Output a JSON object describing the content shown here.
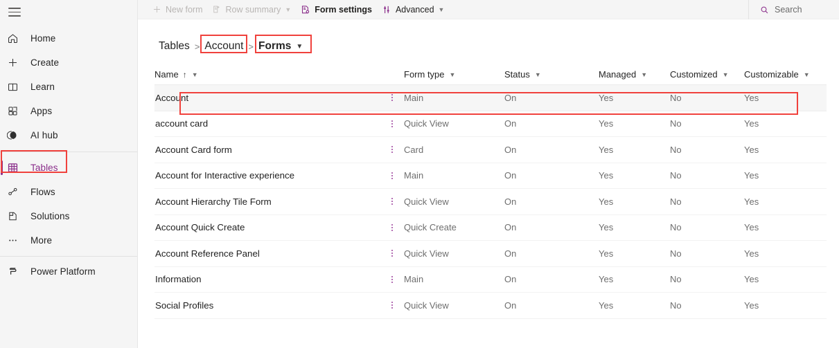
{
  "colors": {
    "accent_purple": "#8a2d8a",
    "annotation_red": "#f0413c",
    "toolbar_bg": "#f5f5f5",
    "sidebar_bg": "#f5f5f5",
    "kebab_purple": "#9b3f9b"
  },
  "sidebar": {
    "menu_button": "hamburger-menu",
    "items": [
      {
        "label": "Home",
        "icon": "home-icon",
        "active": false
      },
      {
        "label": "Create",
        "icon": "plus-icon",
        "active": false
      },
      {
        "label": "Learn",
        "icon": "book-icon",
        "active": false
      },
      {
        "label": "Apps",
        "icon": "apps-icon",
        "active": false
      },
      {
        "label": "AI hub",
        "icon": "ai-hub-icon",
        "active": false
      },
      {
        "label": "Tables",
        "icon": "table-grid-icon",
        "active": true
      },
      {
        "label": "Flows",
        "icon": "flows-icon",
        "active": false
      },
      {
        "label": "Solutions",
        "icon": "solutions-icon",
        "active": false
      },
      {
        "label": "More",
        "icon": "ellipsis-icon",
        "active": false
      }
    ],
    "footer": {
      "label": "Power Platform",
      "icon": "power-platform-icon"
    }
  },
  "toolbar": {
    "commands": [
      {
        "label": "New form",
        "icon": "plus-icon",
        "disabled": true,
        "chevron": false,
        "bold": false
      },
      {
        "label": "Row summary",
        "icon": "row-summary-icon",
        "disabled": true,
        "chevron": true,
        "bold": false
      },
      {
        "label": "Form settings",
        "icon": "form-settings-icon",
        "disabled": false,
        "chevron": false,
        "bold": true
      },
      {
        "label": "Advanced",
        "icon": "advanced-icon",
        "disabled": false,
        "chevron": true,
        "bold": false
      }
    ],
    "search": {
      "placeholder": "Search",
      "icon": "search-icon",
      "value": ""
    }
  },
  "breadcrumb": {
    "items": [
      {
        "label": "Tables",
        "current": false,
        "chevron": false
      },
      {
        "label": "Account",
        "current": false,
        "chevron": false
      },
      {
        "label": "Forms",
        "current": true,
        "chevron": true
      }
    ],
    "separator": ">"
  },
  "grid": {
    "columns": [
      {
        "key": "name",
        "label": "Name",
        "sort": "ascending",
        "sort_glyph": "↑",
        "menu": true
      },
      {
        "key": "type",
        "label": "Form type",
        "sort": null,
        "menu": true
      },
      {
        "key": "status",
        "label": "Status",
        "sort": null,
        "menu": true
      },
      {
        "key": "managed",
        "label": "Managed",
        "sort": null,
        "menu": true
      },
      {
        "key": "customized",
        "label": "Customized",
        "sort": null,
        "menu": true
      },
      {
        "key": "customizable",
        "label": "Customizable",
        "sort": null,
        "menu": true
      }
    ],
    "rows": [
      {
        "name": "Account",
        "type": "Main",
        "status": "On",
        "managed": "Yes",
        "customized": "No",
        "customizable": "Yes",
        "highlighted": true
      },
      {
        "name": "account card",
        "type": "Quick View",
        "status": "On",
        "managed": "Yes",
        "customized": "No",
        "customizable": "Yes",
        "highlighted": false
      },
      {
        "name": "Account Card form",
        "type": "Card",
        "status": "On",
        "managed": "Yes",
        "customized": "No",
        "customizable": "Yes",
        "highlighted": false
      },
      {
        "name": "Account for Interactive experience",
        "type": "Main",
        "status": "On",
        "managed": "Yes",
        "customized": "No",
        "customizable": "Yes",
        "highlighted": false
      },
      {
        "name": "Account Hierarchy Tile Form",
        "type": "Quick View",
        "status": "On",
        "managed": "Yes",
        "customized": "No",
        "customizable": "Yes",
        "highlighted": false
      },
      {
        "name": "Account Quick Create",
        "type": "Quick Create",
        "status": "On",
        "managed": "Yes",
        "customized": "No",
        "customizable": "Yes",
        "highlighted": false
      },
      {
        "name": "Account Reference Panel",
        "type": "Quick View",
        "status": "On",
        "managed": "Yes",
        "customized": "No",
        "customizable": "Yes",
        "highlighted": false
      },
      {
        "name": "Information",
        "type": "Main",
        "status": "On",
        "managed": "Yes",
        "customized": "No",
        "customizable": "Yes",
        "highlighted": false
      },
      {
        "name": "Social Profiles",
        "type": "Quick View",
        "status": "On",
        "managed": "Yes",
        "customized": "No",
        "customizable": "Yes",
        "highlighted": false
      }
    ],
    "row_menu_icon": "more-vertical-icon"
  },
  "annotations": [
    {
      "target": "sidebar-item-tables",
      "shape": "rectangle",
      "color": "#f0413c"
    },
    {
      "target": "breadcrumb-account",
      "shape": "rectangle",
      "color": "#f0413c"
    },
    {
      "target": "breadcrumb-forms",
      "shape": "rectangle",
      "color": "#f0413c"
    },
    {
      "target": "grid-row-account",
      "shape": "rectangle",
      "color": "#f0413c"
    }
  ]
}
